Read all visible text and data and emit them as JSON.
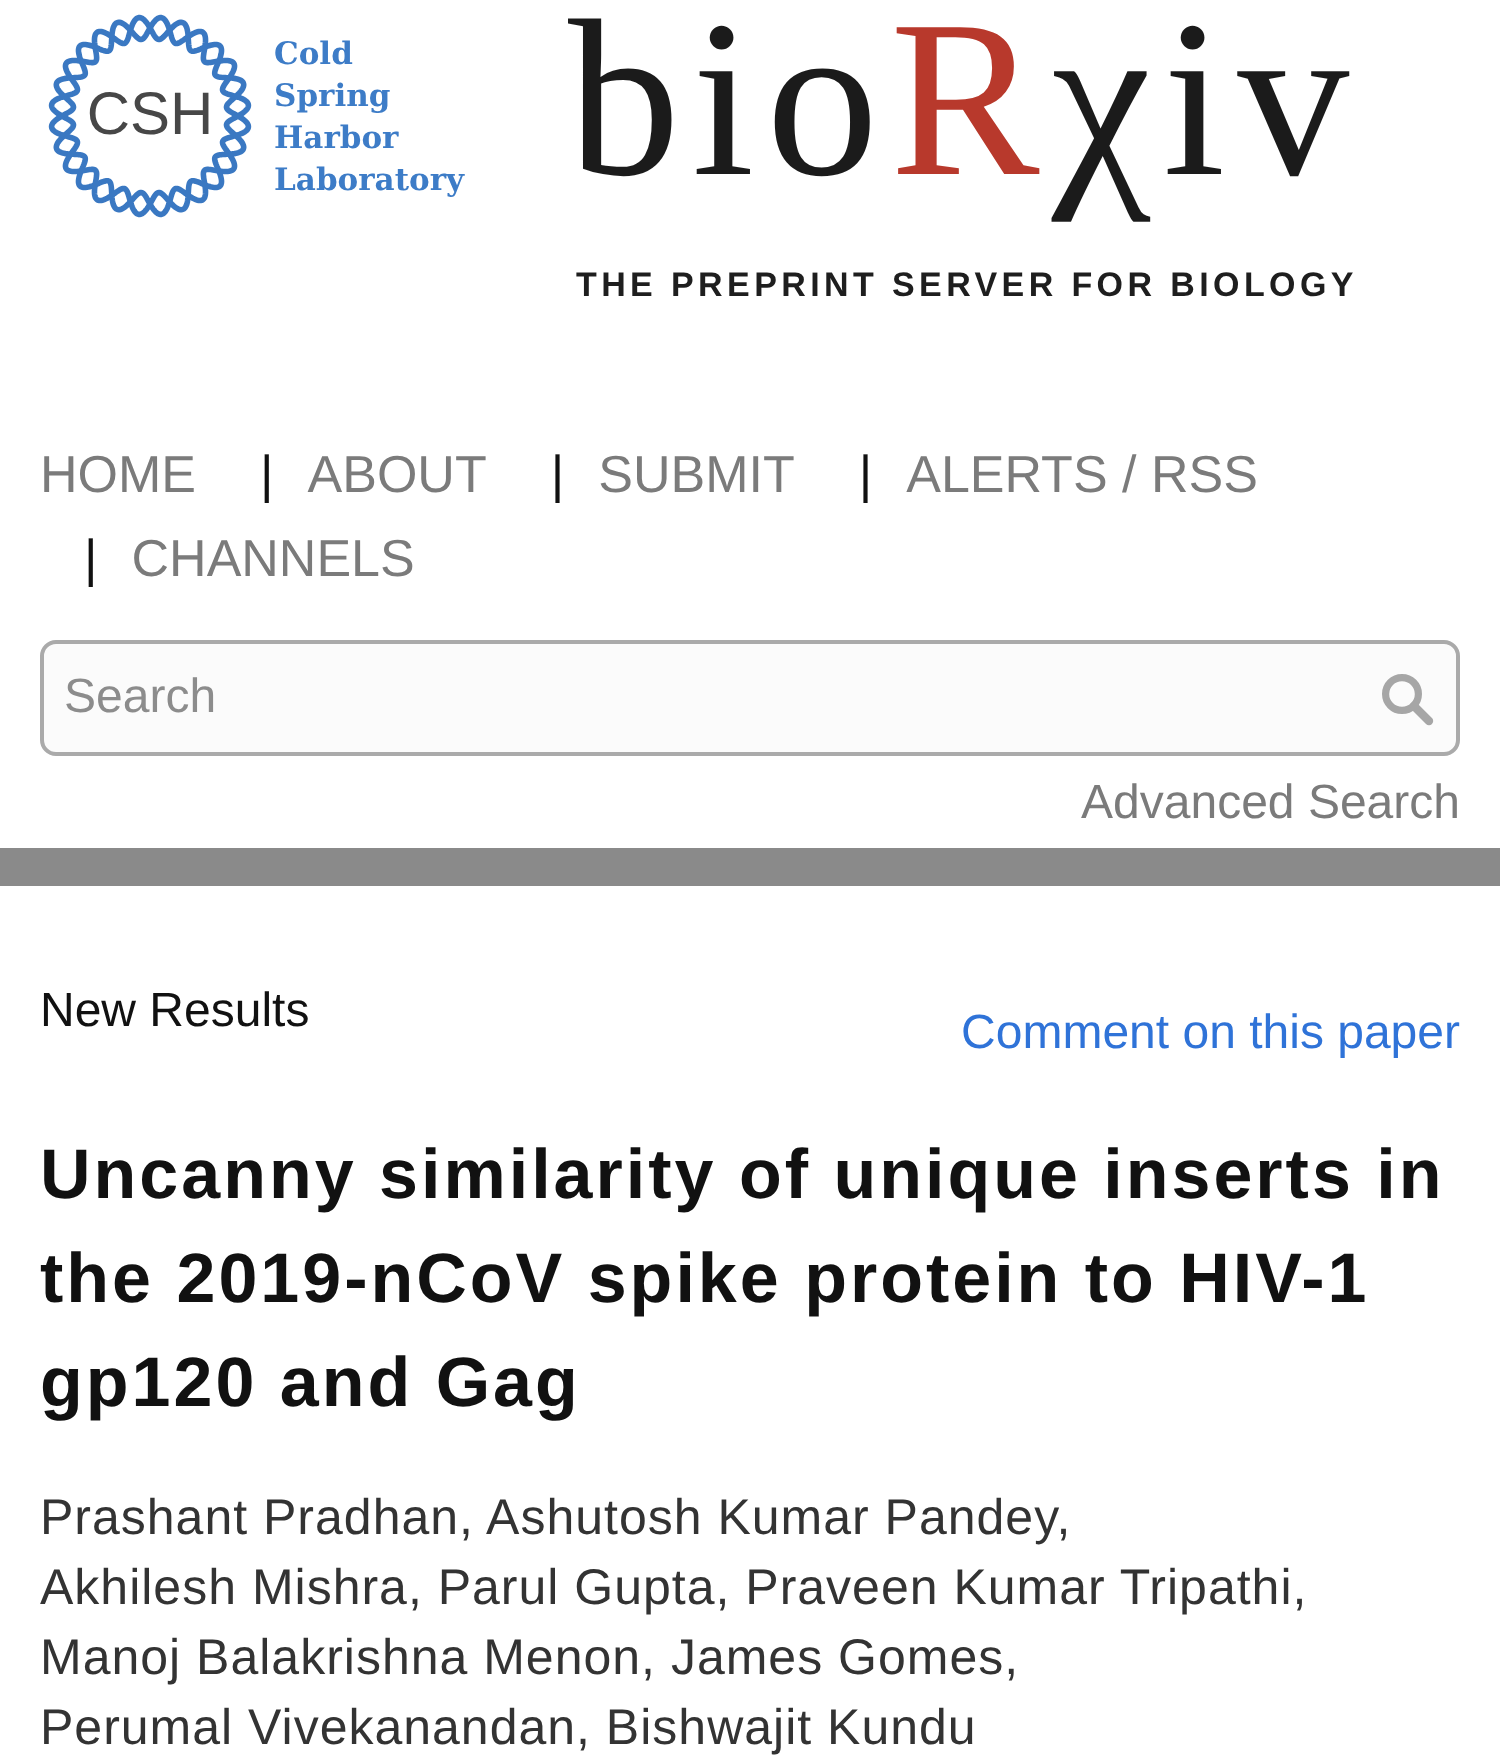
{
  "header": {
    "lab_logo": {
      "initials": "CSH",
      "name": "Cold Spring Harbor Laboratory"
    },
    "wordmark": [
      {
        "text": "bio",
        "accent": false
      },
      {
        "text": "R",
        "accent": true
      },
      {
        "text": "χiv",
        "accent": false
      }
    ],
    "tagline": "THE PREPRINT SERVER FOR BIOLOGY"
  },
  "nav": [
    {
      "label": "HOME"
    },
    {
      "separator": "|",
      "label": "ABOUT"
    },
    {
      "separator": "|",
      "label": "SUBMIT"
    },
    {
      "separator": "|",
      "label": "ALERTS / RSS"
    },
    {
      "separator": "|",
      "label": "CHANNELS"
    }
  ],
  "search": {
    "placeholder": "Search",
    "advanced_link": "Advanced Search"
  },
  "article": {
    "section": "New Results",
    "comment_link": "Comment on this paper",
    "title": "Uncanny similarity of unique inserts in the 2019-nCoV spike protein to HIV-1 gp120 and Gag",
    "author_lines": [
      "Prashant Pradhan, Ashutosh Kumar Pandey,",
      "Akhilesh Mishra, Parul Gupta, Praveen Kumar Tripathi,",
      "Manoj Balakrishna Menon, James Gomes,",
      "Perumal Vivekanandan, Bishwajit Kundu"
    ]
  }
}
